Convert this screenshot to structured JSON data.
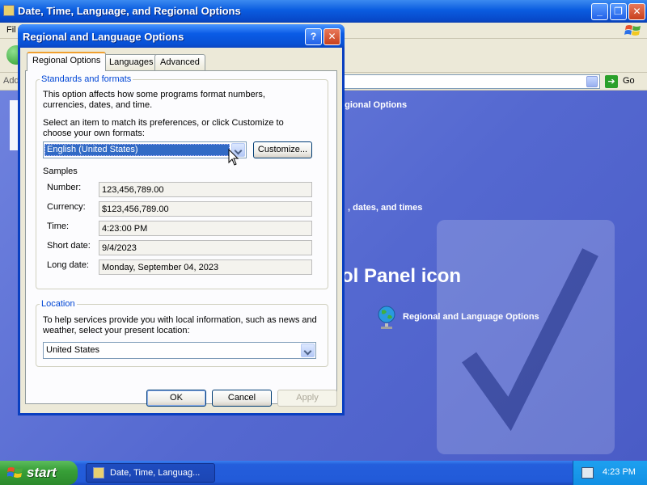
{
  "background_window": {
    "title": "Date, Time, Language, and Regional Options",
    "menu_partial": "Fil",
    "address_label_partial": "Add",
    "go_label": "Go",
    "task_partial": "egional Options",
    "task2_partial": ", dates, and times",
    "heading_partial": "ol Panel icon",
    "cp_icon_label": "Regional and Language Options",
    "title_buttons": {
      "minimize": "_",
      "maximize": "❐",
      "close": "✕"
    }
  },
  "dialog": {
    "title": "Regional and Language Options",
    "help_label": "?",
    "close_label": "✕",
    "tabs": [
      "Regional Options",
      "Languages",
      "Advanced"
    ],
    "standards": {
      "legend": "Standards and formats",
      "desc": "This option affects how some programs format numbers, currencies, dates, and time.",
      "instr": "Select an item to match its preferences, or click Customize to choose your own formats:",
      "selected": "English (United States)",
      "customize_label": "Customize...",
      "samples_label": "Samples",
      "samples": [
        {
          "label": "Number:",
          "value": "123,456,789.00"
        },
        {
          "label": "Currency:",
          "value": "$123,456,789.00"
        },
        {
          "label": "Time:",
          "value": "4:23:00 PM"
        },
        {
          "label": "Short date:",
          "value": "9/4/2023"
        },
        {
          "label": "Long date:",
          "value": "Monday, September 04, 2023"
        }
      ]
    },
    "location": {
      "legend": "Location",
      "desc": "To help services provide you with local information, such as news and weather, select your present location:",
      "selected": "United States"
    },
    "buttons": {
      "ok": "OK",
      "cancel": "Cancel",
      "apply": "Apply"
    }
  },
  "taskbar": {
    "start_label": "start",
    "task_label": "Date, Time, Languag...",
    "clock": "4:23 PM"
  },
  "colors": {
    "xp_blue": "#0a5ce6",
    "group_label": "#0046d5",
    "start_green": "#38a038"
  }
}
